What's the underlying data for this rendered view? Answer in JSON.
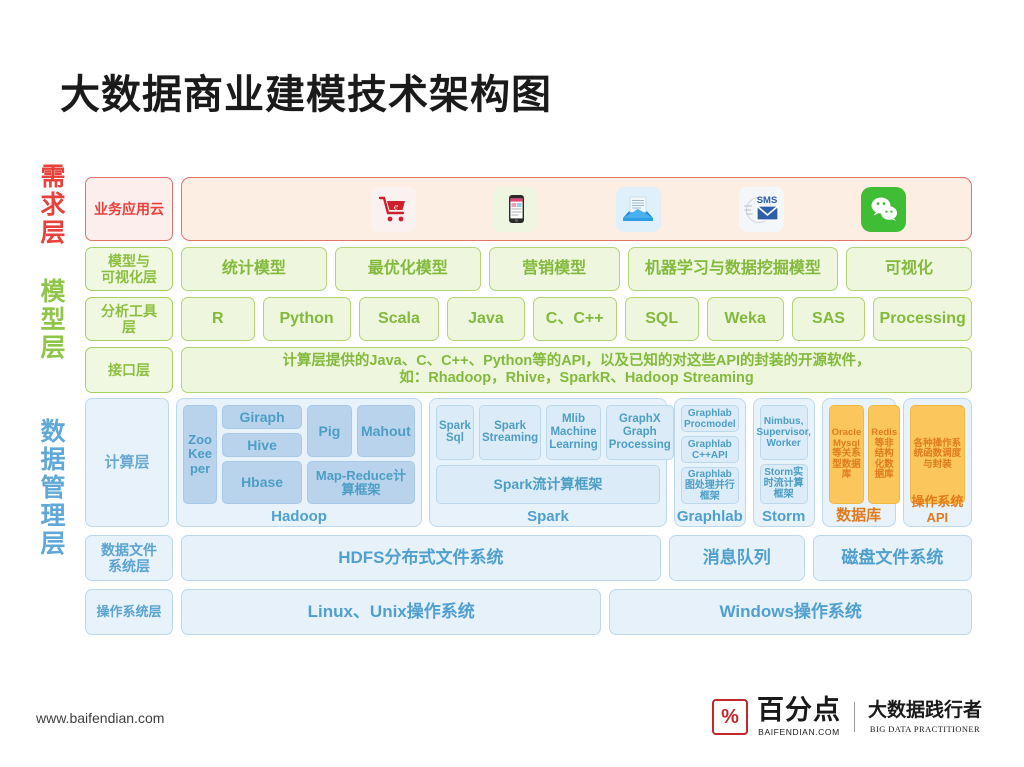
{
  "title": "大数据商业建模技术架构图",
  "side_labels": [
    {
      "name": "demand",
      "text": "需求层",
      "color": "#e8403a"
    },
    {
      "name": "model",
      "text": "模型层",
      "color": "#8fc64a"
    },
    {
      "name": "data",
      "text": "数据管理层",
      "color": "#5fa8d8"
    }
  ],
  "app_layer": {
    "label": "业务应用云",
    "icons": [
      {
        "name": "shopping-cart-icon",
        "glyph": "🛒",
        "label": "电商"
      },
      {
        "name": "mobile-phone-icon",
        "glyph": "📱",
        "label": "移动应用"
      },
      {
        "name": "email-icon",
        "glyph": "✉",
        "label": "邮件"
      },
      {
        "name": "sms-icon",
        "glyph": "SMS",
        "label": "短信"
      },
      {
        "name": "wechat-icon",
        "glyph": "💬",
        "label": "微信"
      }
    ]
  },
  "model_layer": {
    "label": "模型与\n可视化层",
    "label_line1": "模型与",
    "label_line2": "可视化层",
    "items": [
      "统计模型",
      "最优化模型",
      "营销模型",
      "机器学习与数据挖掘模型",
      "可视化"
    ]
  },
  "tool_layer": {
    "label_line1": "分析工具",
    "label_line2": "层",
    "items": [
      "R",
      "Python",
      "Scala",
      "Java",
      "C、C++",
      "SQL",
      "Weka",
      "SAS",
      "Processing"
    ]
  },
  "api_layer": {
    "label": "接口层",
    "line1": "计算层提供的Java、C、C++、Python等的API，以及已知的对这些API的封装的开源软件，",
    "line2": "如：Rhadoop，Rhive，SparkR、Hadoop Streaming"
  },
  "compute_layer": {
    "label": "计算层",
    "groups": [
      {
        "name": "Hadoop",
        "zookeeper": "Zoo\nKee\nper",
        "zk_l1": "Zoo",
        "zk_l2": "Kee",
        "zk_l3": "per",
        "items": [
          "Giraph",
          "Hive",
          "Hbase",
          "Pig",
          "Mahout",
          "Map-Reduce计算框架"
        ]
      },
      {
        "name": "Spark",
        "items": [
          "Spark Sql",
          "Spark Streaming",
          "Mlib Machine Learning",
          "GraphX Graph Processing",
          "Spark流计算框架"
        ]
      },
      {
        "name": "Graphlab",
        "items": [
          "Graphlab Procmodel",
          "Graphlab C++API",
          "Graphlab图处理并行框架"
        ]
      },
      {
        "name": "Storm",
        "items": [
          "Nimbus, Supervisor, Worker",
          "Storm实时流计算框架"
        ]
      },
      {
        "name": "数据库",
        "items": [
          "Oracle Mysql等关系型数据库",
          "Redis等非结构化数据库"
        ]
      },
      {
        "name": "操作系统API",
        "items": [
          "各种操作系统函数调度与封装"
        ]
      }
    ]
  },
  "file_layer": {
    "label_line1": "数据文件",
    "label_line2": "系统层",
    "items": [
      "HDFS分布式文件系统",
      "消息队列",
      "磁盘文件系统"
    ]
  },
  "os_layer": {
    "label": "操作系统层",
    "items": [
      "Linux、Unix操作系统",
      "Windows操作系统"
    ]
  },
  "footer": {
    "url": "www.baifendian.com",
    "logo_mark": "%",
    "logo_cn": "百分点",
    "logo_en": "BAIFENDIAN.COM",
    "slogan_cn": "大数据践行者",
    "slogan_en": "BIG DATA PRACTITIONER"
  }
}
